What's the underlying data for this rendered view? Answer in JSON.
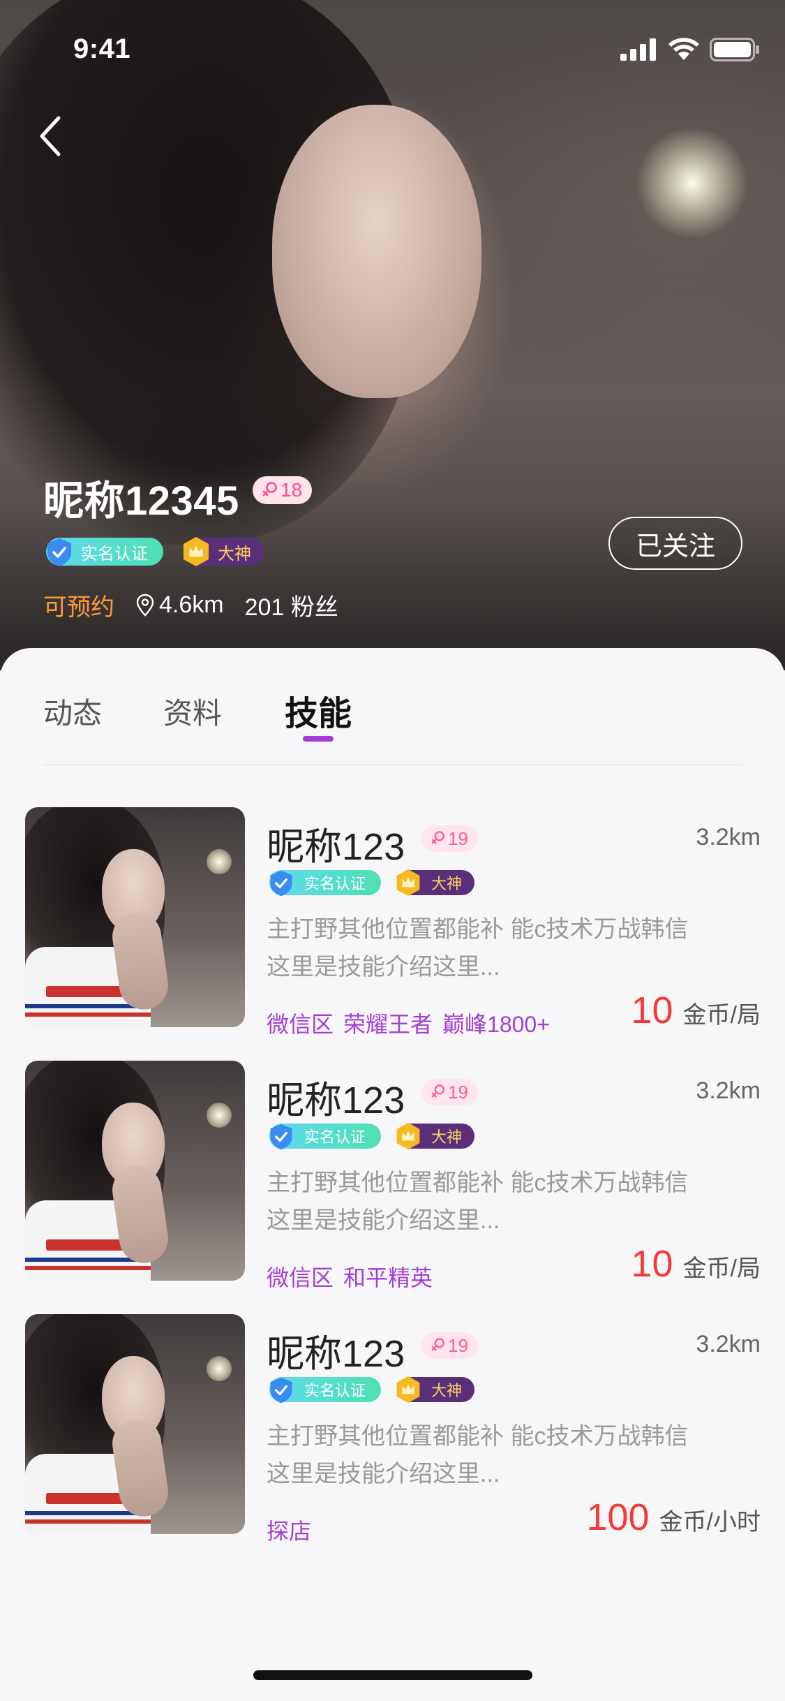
{
  "status_bar": {
    "time": "9:41"
  },
  "profile": {
    "name": "昵称12345",
    "age": "18",
    "verified_label": "实名认证",
    "god_label": "大神",
    "follow_label": "已关注",
    "bookable_label": "可预约",
    "distance": "4.6km",
    "fans": "201 粉丝"
  },
  "tabs": [
    {
      "label": "动态",
      "active": false
    },
    {
      "label": "资料",
      "active": false
    },
    {
      "label": "技能",
      "active": true
    }
  ],
  "skills": [
    {
      "name": "昵称123",
      "age": "19",
      "distance": "3.2km",
      "verified_label": "实名认证",
      "god_label": "大神",
      "desc_line1": "主打野其他位置都能补   能c技术万战韩信",
      "desc_line2": "这里是技能介绍这里...",
      "tags": [
        "微信区",
        "荣耀王者",
        "巅峰1800+"
      ],
      "price": "10",
      "unit": "金币/局"
    },
    {
      "name": "昵称123",
      "age": "19",
      "distance": "3.2km",
      "verified_label": "实名认证",
      "god_label": "大神",
      "desc_line1": "主打野其他位置都能补   能c技术万战韩信",
      "desc_line2": "这里是技能介绍这里...",
      "tags": [
        "微信区",
        "和平精英"
      ],
      "price": "10",
      "unit": "金币/局"
    },
    {
      "name": "昵称123",
      "age": "19",
      "distance": "3.2km",
      "verified_label": "实名认证",
      "god_label": "大神",
      "desc_line1": "主打野其他位置都能补   能c技术万战韩信",
      "desc_line2": "这里是技能介绍这里...",
      "tags": [
        "探店"
      ],
      "price": "100",
      "unit": "金币/小时"
    }
  ],
  "colors": {
    "accent_purple": "#a83bd9",
    "price_red": "#f43a36",
    "bookable_orange": "#ff9a3a",
    "tag_purple": "#a33fd0"
  }
}
